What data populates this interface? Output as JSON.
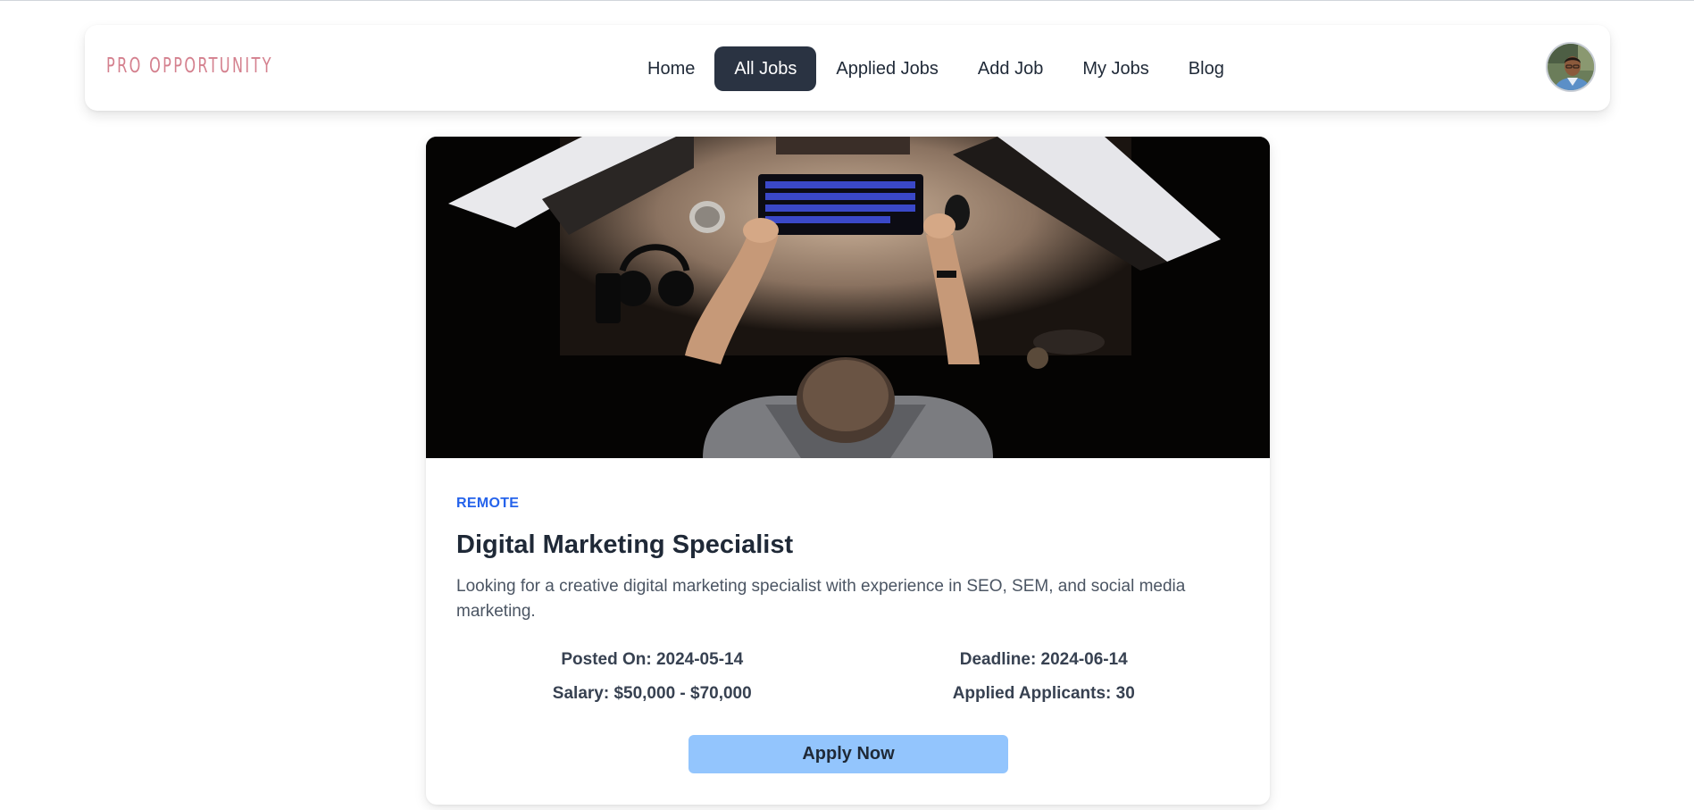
{
  "brand": {
    "logo_text": "PRO OPPORTUNITY",
    "accent": "#d4808e"
  },
  "nav": {
    "items": [
      {
        "label": "Home",
        "active": false
      },
      {
        "label": "All Jobs",
        "active": true
      },
      {
        "label": "Applied Jobs",
        "active": false
      },
      {
        "label": "Add Job",
        "active": false
      },
      {
        "label": "My Jobs",
        "active": false
      },
      {
        "label": "Blog",
        "active": false
      }
    ]
  },
  "user": {
    "avatar_icon": "user-avatar"
  },
  "job": {
    "image_icon": "workspace-photo",
    "type": "REMOTE",
    "title": "Digital Marketing Specialist",
    "description": "Looking for a creative digital marketing specialist with experience in SEO, SEM, and social media marketing.",
    "posted_on": "Posted On: 2024-05-14",
    "deadline": "Deadline: 2024-06-14",
    "salary": "Salary: $50,000 - $70,000",
    "applicants": "Applied Applicants: 30",
    "apply_label": "Apply Now"
  },
  "colors": {
    "nav_active_bg": "#2a3342",
    "badge_blue": "#2563eb",
    "apply_bg": "#93c5fd"
  }
}
